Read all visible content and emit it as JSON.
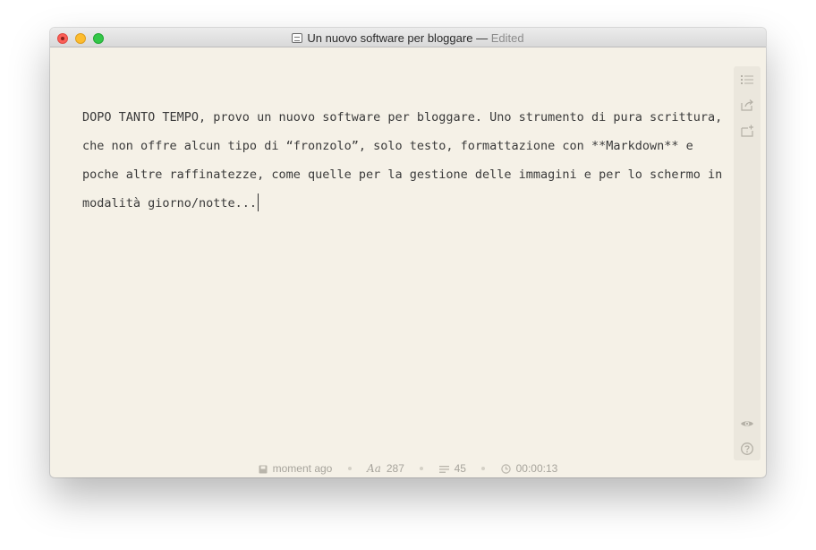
{
  "window": {
    "title": "Un nuovo software per bloggare",
    "title_separator": "—",
    "edited_label": "Edited",
    "colors": {
      "background": "#f5f1e7",
      "sidebar": "#ebe7dd",
      "close": "#fc5f57",
      "minimize": "#fdbc2e",
      "zoom": "#33c748"
    }
  },
  "editor": {
    "text": "DOPO TANTO TEMPO, provo un nuovo software per bloggare. Uno strumento di pura scrittura, che non offre alcun tipo di “fronzolo”, solo testo, formattazione con **Markdown** e poche altre raffinatezze, come quelle per la gestione delle immagini e per lo schermo in modalità giorno/notte..."
  },
  "sidebar": {
    "icons": [
      "list-icon",
      "share-icon",
      "export-icon",
      "preview-eye-icon",
      "help-icon"
    ]
  },
  "statusbar": {
    "saved_label": "moment ago",
    "words_symbol": "Aa",
    "words_count": "287",
    "lines_count": "45",
    "reading_time": "00:00:13"
  }
}
